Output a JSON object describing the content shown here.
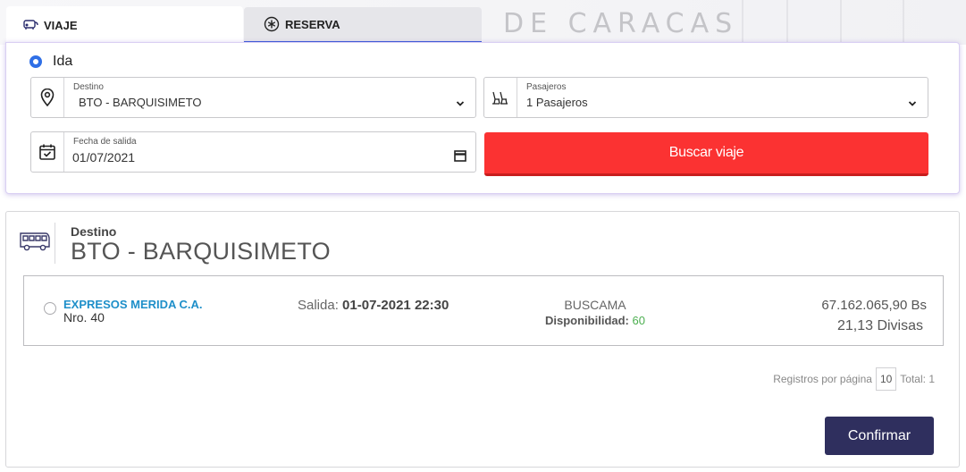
{
  "background": {
    "banner_text": "DE CARACAS"
  },
  "tabs": [
    {
      "label": "VIAJE",
      "icon": "bus-route-icon",
      "active": true
    },
    {
      "label": "RESERVA",
      "icon": "asterisk-circle-icon",
      "active": false
    }
  ],
  "search": {
    "trip_type": {
      "label": "Ida",
      "selected": true
    },
    "destino": {
      "label": "Destino",
      "value": "BTO - BARQUISIMETO",
      "icon": "location-pin-icon"
    },
    "pasajeros": {
      "label": "Pasajeros",
      "value": "1 Pasajeros",
      "icon": "seats-icon"
    },
    "fecha": {
      "label": "Fecha de salida",
      "value": "01/07/2021",
      "icon": "calendar-check-icon"
    },
    "search_button": "Buscar viaje"
  },
  "results": {
    "destino_label": "Destino",
    "destino_value": "BTO - BARQUISIMETO",
    "trips": [
      {
        "company": "EXPRESOS MERIDA C.A.",
        "number": "Nro. 40",
        "salida_label": "Salida:",
        "salida_value": "01-07-2021 22:30",
        "clase": "BUSCAMA",
        "disponibilidad_label": "Disponibilidad:",
        "disponibilidad_value": "60",
        "price_bs": "67.162.065,90 Bs",
        "price_divisas": "21,13 Divisas"
      }
    ],
    "pager": {
      "label": "Registros por página",
      "per_page": "10",
      "total": "Total: 1"
    },
    "confirm_button": "Confirmar"
  },
  "colors": {
    "accent_red": "#fb3232",
    "confirm_navy": "#2f2f5e",
    "company_blue": "#1e8fc9",
    "radio_blue": "#2f6fe6",
    "availability_green": "#4caf50"
  }
}
